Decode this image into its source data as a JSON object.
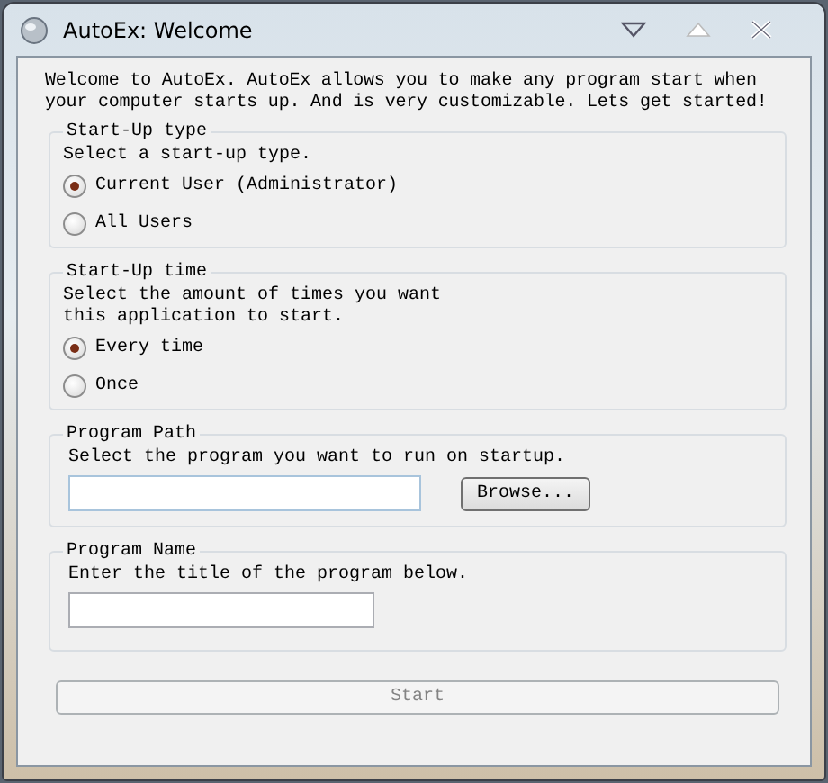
{
  "window": {
    "title": "AutoEx: Welcome"
  },
  "intro": "Welcome to AutoEx. AutoEx allows you to make any program start when your computer starts up. And is very customizable. Lets get started!",
  "groups": [
    {
      "kind": "radio",
      "title": "Start-Up type",
      "description": "Select a start-up type.",
      "options": [
        {
          "label": "Current User (Administrator)",
          "selected": true
        },
        {
          "label": "All Users",
          "selected": false
        }
      ]
    },
    {
      "kind": "radio",
      "title": "Start-Up time",
      "description": "Select the amount of times you want this application to start.",
      "options": [
        {
          "label": "Every time",
          "selected": true
        },
        {
          "label": "Once",
          "selected": false
        }
      ]
    },
    {
      "kind": "path",
      "title": "Program Path",
      "description": "Select the program you want to run on startup.",
      "button": "Browse..."
    },
    {
      "kind": "name",
      "title": "Program Name",
      "description": "Enter the title of the program below."
    }
  ],
  "start_button": {
    "label": "Start",
    "disabled": true
  }
}
